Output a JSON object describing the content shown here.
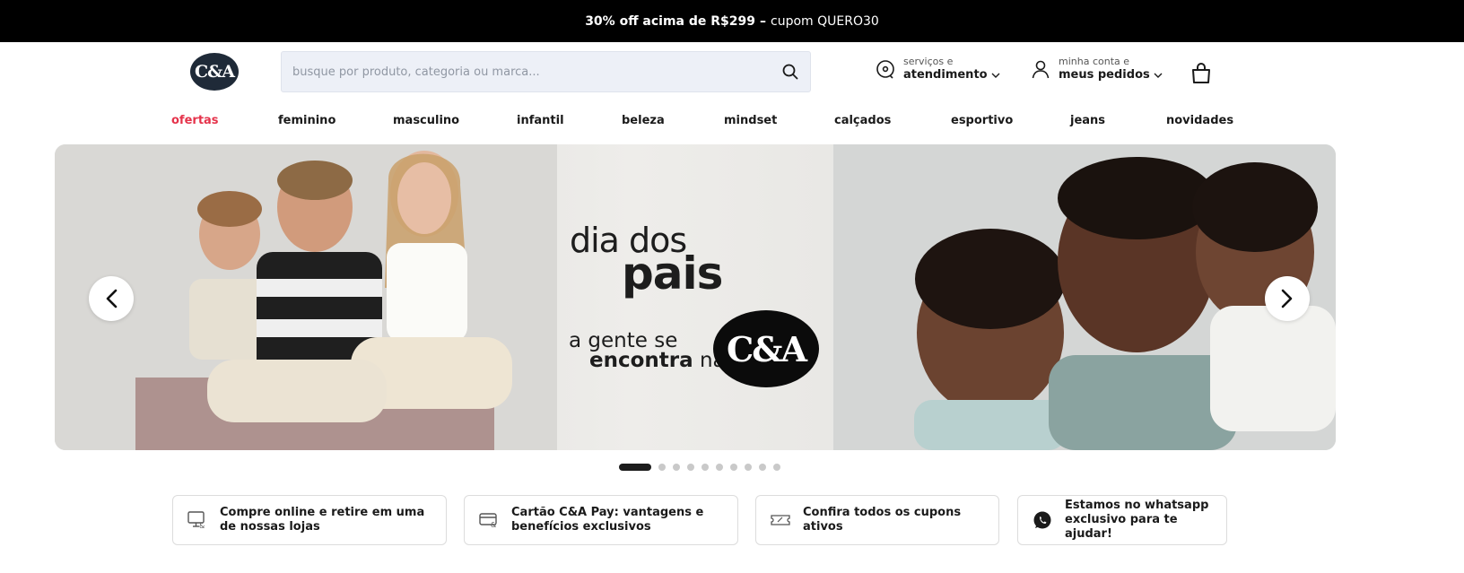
{
  "promo": {
    "strong": "30% off acima de R$299",
    "dash": "–",
    "coupon": "cupom QUERO30"
  },
  "header": {
    "logo_text": "C&A",
    "search_placeholder": "busque por produto, categoria ou marca...",
    "services_small": "serviços e",
    "services_big": "atendimento",
    "account_small": "minha conta e",
    "account_big": "meus pedidos",
    "icons": {
      "search": "search-icon",
      "services": "headset-icon",
      "account": "user-icon",
      "bag": "shopping-bag-icon"
    }
  },
  "nav": {
    "items": [
      "ofertas",
      "feminino",
      "masculino",
      "infantil",
      "beleza",
      "mindset",
      "calçados",
      "esportivo",
      "jeans",
      "novidades"
    ],
    "accent_color": "#e5334b"
  },
  "hero": {
    "title_line1": "dia dos",
    "title_line2": "pais",
    "tag_line1": "a gente se",
    "tag_bold": "encontra",
    "tag_rest": "na",
    "logo_text": "C&A",
    "slide_count": 10,
    "active_slide": 1
  },
  "features": [
    {
      "text": "Compre online e retire em uma de nossas lojas",
      "icon": "monitor-store-icon"
    },
    {
      "text": "Cartão C&A Pay: vantagens e benefícios exclusivos",
      "icon": "credit-card-icon"
    },
    {
      "text": "Confira todos os cupons ativos",
      "icon": "coupon-icon"
    },
    {
      "text": "Estamos no whatsapp exclusivo para te ajudar!",
      "icon": "whatsapp-icon"
    }
  ]
}
